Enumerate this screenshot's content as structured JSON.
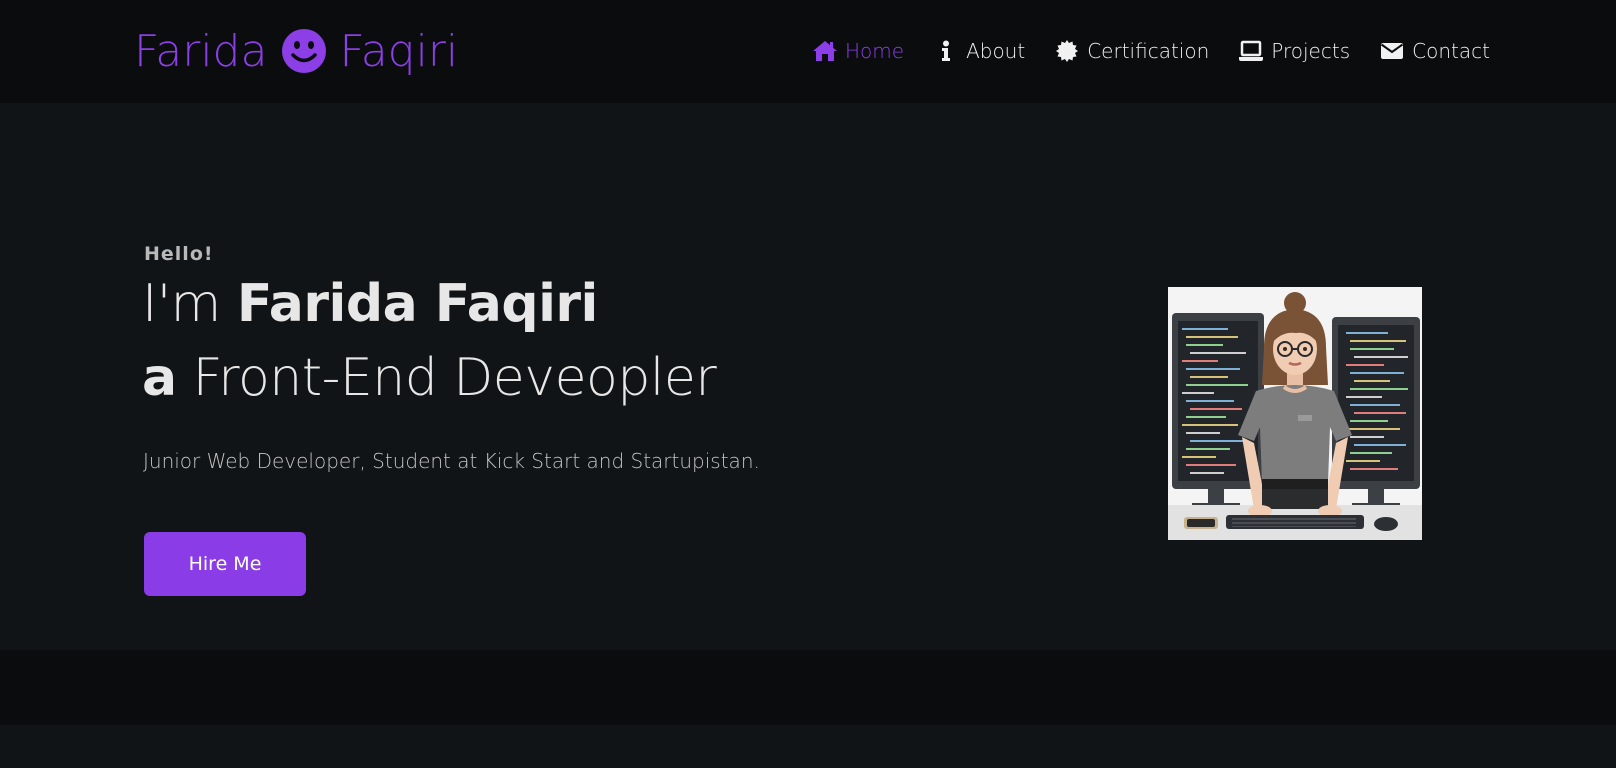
{
  "brand": {
    "first": "Farida",
    "last": "Faqiri",
    "icon": "smiley-icon"
  },
  "nav": {
    "items": [
      {
        "label": "Home",
        "icon": "home-icon",
        "active": true
      },
      {
        "label": "About",
        "icon": "info-icon",
        "active": false
      },
      {
        "label": "Certification",
        "icon": "certificate-icon",
        "active": false
      },
      {
        "label": "Projects",
        "icon": "laptop-icon",
        "active": false
      },
      {
        "label": "Contact",
        "icon": "envelope-icon",
        "active": false
      }
    ]
  },
  "hero": {
    "greeting": "Hello!",
    "intro_prefix": "I'm",
    "name": "Farida Faqiri",
    "role_prefix": "a",
    "role": "Front-End Deveopler",
    "tagline": "Junior Web Developer, Student at Kick Start and Startupistan.",
    "button_label": "Hire Me"
  },
  "colors": {
    "accent": "#8c3fe6",
    "navbar_bg": "#0b0c0e",
    "page_bg": "#111416",
    "text": "#e7e7e7"
  }
}
